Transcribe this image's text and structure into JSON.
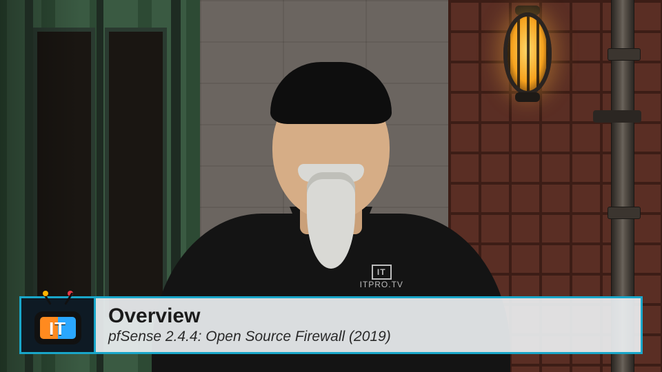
{
  "lower_third": {
    "title": "Overview",
    "subtitle": "pfSense 2.4.4: Open Source Firewall (2019)"
  },
  "logo": {
    "text": "IT",
    "brand_sub": "ITPRO.TV"
  },
  "colors": {
    "accent": "#19a6c9",
    "panel_bg": "rgba(236,239,241,.92)",
    "logo_orange": "#ff8a1f",
    "logo_blue": "#2aa7ff"
  }
}
